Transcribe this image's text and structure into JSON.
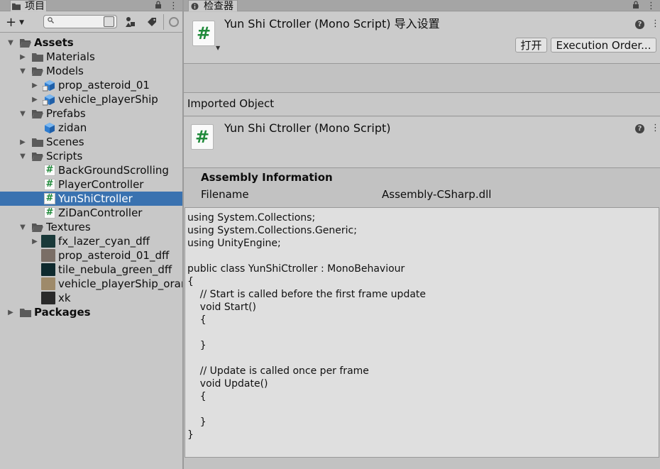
{
  "project_panel": {
    "tab_title": "项目",
    "search": {
      "value": "",
      "placeholder": ""
    },
    "tree": [
      {
        "label": "Assets",
        "kind": "folder-open",
        "depth": 0,
        "expanded": true,
        "bold": true
      },
      {
        "label": "Materials",
        "kind": "folder",
        "depth": 1,
        "expanded": false
      },
      {
        "label": "Models",
        "kind": "folder-open",
        "depth": 1,
        "expanded": true
      },
      {
        "label": "prop_asteroid_01",
        "kind": "model",
        "depth": 2,
        "expanded": false
      },
      {
        "label": "vehicle_playerShip",
        "kind": "model",
        "depth": 2,
        "expanded": false
      },
      {
        "label": "Prefabs",
        "kind": "folder-open",
        "depth": 1,
        "expanded": true
      },
      {
        "label": "zidan",
        "kind": "prefab",
        "depth": 2,
        "expanded": null
      },
      {
        "label": "Scenes",
        "kind": "folder",
        "depth": 1,
        "expanded": false
      },
      {
        "label": "Scripts",
        "kind": "folder-open",
        "depth": 1,
        "expanded": true
      },
      {
        "label": "BackGroundScrolling",
        "kind": "script",
        "depth": 2,
        "expanded": null
      },
      {
        "label": "PlayerController",
        "kind": "script",
        "depth": 2,
        "expanded": null
      },
      {
        "label": "YunShiCtroller",
        "kind": "script",
        "depth": 2,
        "expanded": null,
        "selected": true
      },
      {
        "label": "ZiDanController",
        "kind": "script",
        "depth": 2,
        "expanded": null
      },
      {
        "label": "Textures",
        "kind": "folder-open",
        "depth": 1,
        "expanded": true
      },
      {
        "label": "fx_lazer_cyan_dff",
        "kind": "texture",
        "depth": 2,
        "expanded": false,
        "color": "#1a3a3a"
      },
      {
        "label": "prop_asteroid_01_dff",
        "kind": "texture",
        "depth": 2,
        "expanded": null,
        "color": "#7a6e66"
      },
      {
        "label": "tile_nebula_green_dff",
        "kind": "texture",
        "depth": 2,
        "expanded": null,
        "color": "#0e2a2e"
      },
      {
        "label": "vehicle_playerShip_orange_dff",
        "kind": "texture",
        "depth": 2,
        "expanded": null,
        "color": "#9e8a6a"
      },
      {
        "label": "xk",
        "kind": "texture",
        "depth": 2,
        "expanded": null,
        "color": "#2a2a2a"
      },
      {
        "label": "Packages",
        "kind": "folder",
        "depth": 0,
        "expanded": false,
        "bold": true
      }
    ]
  },
  "inspector": {
    "tab_title": "检查器",
    "header": {
      "title": "Yun Shi Ctroller (Mono Script) 导入设置",
      "open_button": "打开",
      "execution_order_button": "Execution Order..."
    },
    "imported_object_label": "Imported Object",
    "object_title": "Yun Shi Ctroller (Mono Script)",
    "assembly": {
      "header": "Assembly Information",
      "key": "Filename",
      "value": "Assembly-CSharp.dll"
    },
    "code_lines": [
      "using System.Collections;",
      "using System.Collections.Generic;",
      "using UnityEngine;",
      "",
      "public class YunShiCtroller : MonoBehaviour",
      "{",
      "    // Start is called before the first frame update",
      "    void Start()",
      "    {",
      "",
      "    }",
      "",
      "    // Update is called once per frame",
      "    void Update()",
      "    {",
      "",
      "    }",
      "}"
    ]
  },
  "colors": {
    "selection": "#3a72b0",
    "script_hash": "#1f8a3a",
    "model_cube": "#3e8ad6"
  }
}
